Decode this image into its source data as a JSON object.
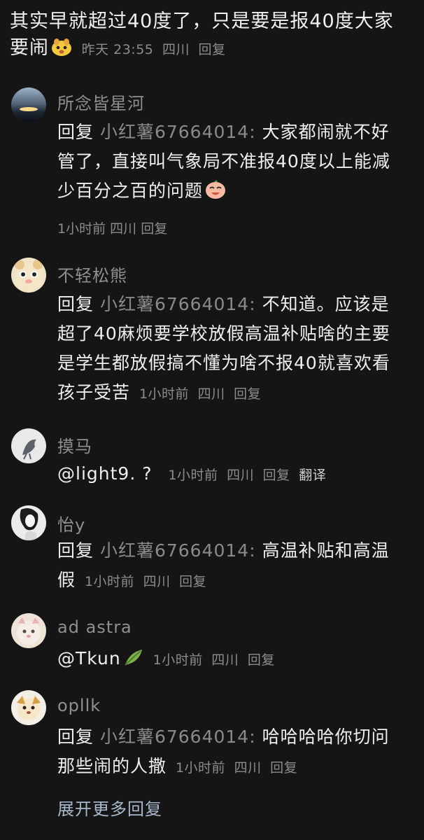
{
  "top_cut_text": "",
  "main_comment": {
    "text": "其实早就超过40度了，只是要是报40度大家要闹",
    "emoji": "dog-face-emoji",
    "time": "昨天 23:55",
    "location": "四川",
    "reply_label": "回复"
  },
  "replies": [
    {
      "username": "所念皆星河",
      "prefix": "回复",
      "target": "小红薯67664014:",
      "text": "大家都闹就不好管了，直接叫气象局不准报40度以上能减少百分之百的问题",
      "emoji": "laughing-face-emoji",
      "time": "1小时前",
      "location": "四川",
      "reply_label": "回复"
    },
    {
      "username": "不轻松熊",
      "prefix": "回复",
      "target": "小红薯67664014:",
      "text": "不知道。应该是超了40麻烦要学校放假高温补贴啥的主要是学生都放假搞不懂为啥不报40就喜欢看孩子受苦",
      "time": "1小时前",
      "location": "四川",
      "reply_label": "回复"
    },
    {
      "username": "摸马",
      "text": "@light9. ?",
      "time": "1小时前",
      "location": "四川",
      "reply_label": "回复",
      "translate_label": "翻译"
    },
    {
      "username": "怡y",
      "prefix": "回复",
      "target": "小红薯67664014:",
      "text": "高温补贴和高温假",
      "time": "1小时前",
      "location": "四川",
      "reply_label": "回复"
    },
    {
      "username": "ad astra",
      "text": "@Tkun",
      "emoji": "leaf-emoji",
      "time": "1小时前",
      "location": "四川",
      "reply_label": "回复"
    },
    {
      "username": "opllk",
      "prefix": "回复",
      "target": "小红薯67664014:",
      "text": "哈哈哈哈你切问那些闹的人撒",
      "time": "1小时前",
      "location": "四川",
      "reply_label": "回复"
    }
  ],
  "expand_label": "展开更多回复",
  "colors": {
    "background": "#151515",
    "text": "#f0efec",
    "muted": "#8c8c8c",
    "link": "#a9b9cc"
  }
}
